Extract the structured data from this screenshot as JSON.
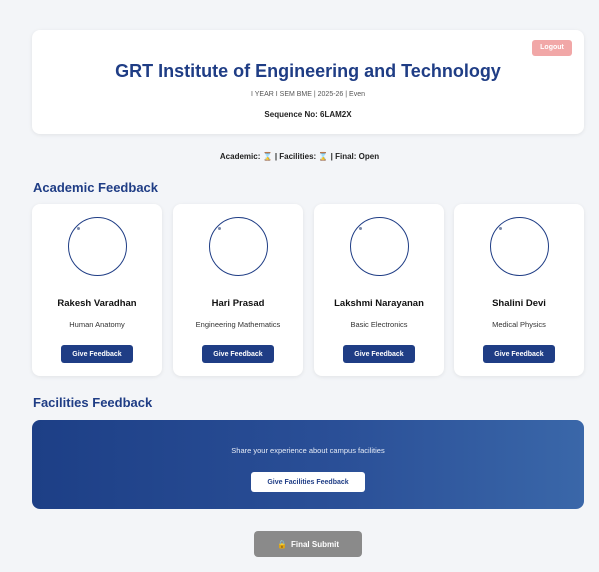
{
  "header": {
    "logout_label": "Logout",
    "institute": "GRT Institute of Engineering and Technology",
    "subline": "I YEAR I SEM BME | 2025-26 | Even",
    "sequence": "Sequence No: 6LAM2X"
  },
  "status": {
    "academic_label": "Academic:",
    "hourglass": "⌛",
    "facilities_label": "| Facilities:",
    "final_label": "| Final: Open"
  },
  "academic": {
    "title": "Academic Feedback",
    "button_label": "Give Feedback",
    "teachers": [
      {
        "name": "Rakesh Varadhan",
        "subject": "Human Anatomy"
      },
      {
        "name": "Hari Prasad",
        "subject": "Engineering Mathematics"
      },
      {
        "name": "Lakshmi Narayanan",
        "subject": "Basic Electronics"
      },
      {
        "name": "Shalini Devi",
        "subject": "Medical Physics"
      }
    ]
  },
  "facilities": {
    "title": "Facilities Feedback",
    "text": "Share your experience about campus facilities",
    "button_label": "Give Facilities Feedback"
  },
  "final": {
    "icon": "lock-icon",
    "glyph": "🔒",
    "label": "Final Submit"
  },
  "colors": {
    "primary": "#1f3d85",
    "logout": "#f1a7a7",
    "final_disabled": "#8a8a8a"
  }
}
